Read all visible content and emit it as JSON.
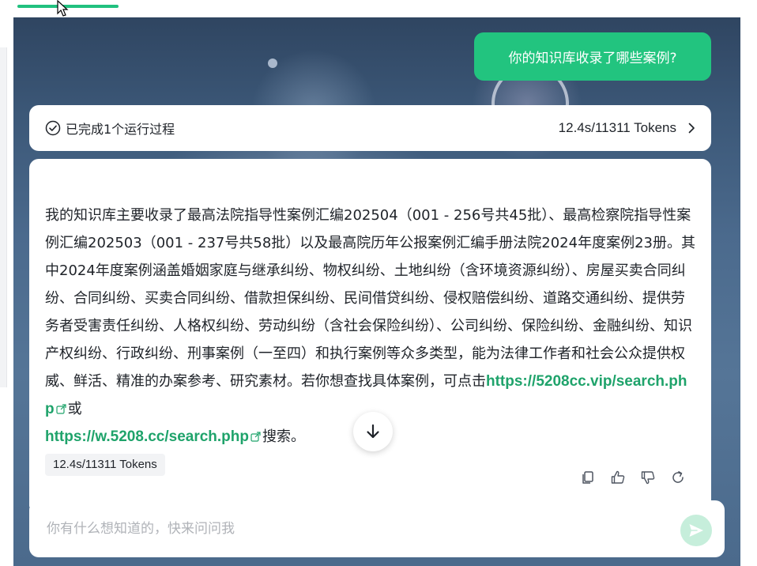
{
  "user_message": "你的知识库收录了哪些案例?",
  "process": {
    "status": "已完成1个运行过程",
    "stats": "12.4s/11311 Tokens"
  },
  "answer": {
    "text_before_link1": "我的知识库主要收录了最高法院指导性案例汇编202504（001 - 256号共45批）、最高检察院指导性案例汇编202503（001 - 237号共58批）以及最高院历年公报案例汇编手册法院2024年度案例23册。其中2024年度案例涵盖婚姻家庭与继承纠纷、物权纠纷、土地纠纷（含环境资源纠纷）、房屋买卖合同纠纷、合同纠纷、买卖合同纠纷、借款担保纠纷、民间借贷纠纷、侵权赔偿纠纷、道路交通纠纷、提供劳务者受害责任纠纷、人格权纠纷、劳动纠纷（含社会保险纠纷）、公司纠纷、保险纠纷、金融纠纷、知识产权纠纷、行政纠纷、刑事案例（一至四）和执行案例等众多类型，能为法律工作者和社会公众提供权威、鲜活、精准的办案参考、研究素材。若你想查找具体案例，可点击",
    "link1": "https://5208cc.vip/search.php",
    "text_between": "或",
    "link2": "https://w.5208.cc/search.php",
    "text_after": "搜索。",
    "token_badge": "12.4s/11311 Tokens"
  },
  "input": {
    "placeholder": "你有什么想知道的，快来问问我",
    "value": ""
  },
  "colors": {
    "accent": "#22c47f",
    "link": "#1fa36b",
    "send_disabled": "#c6eedb"
  },
  "icons": {
    "process_status": "check-circle-icon",
    "process_expand": "chevron-right-icon",
    "link_external": "external-link-icon",
    "copy": "copy-icon",
    "like": "thumbs-up-icon",
    "dislike": "thumbs-down-icon",
    "regenerate": "refresh-icon",
    "scroll_down": "arrow-down-icon",
    "send": "send-icon"
  }
}
